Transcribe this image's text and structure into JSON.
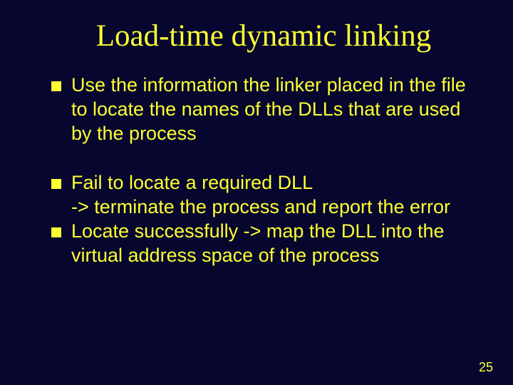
{
  "title": "Load-time dynamic linking",
  "bullets": {
    "group1": {
      "item0": "Use the information the linker placed in the file to locate the names of the DLLs that are used by the process"
    },
    "group2": {
      "item0": "Fail to locate a required DLL\n-> terminate the process and report the error",
      "item1": "Locate successfully -> map the DLL into the virtual address space of the process"
    }
  },
  "page_number": "25"
}
